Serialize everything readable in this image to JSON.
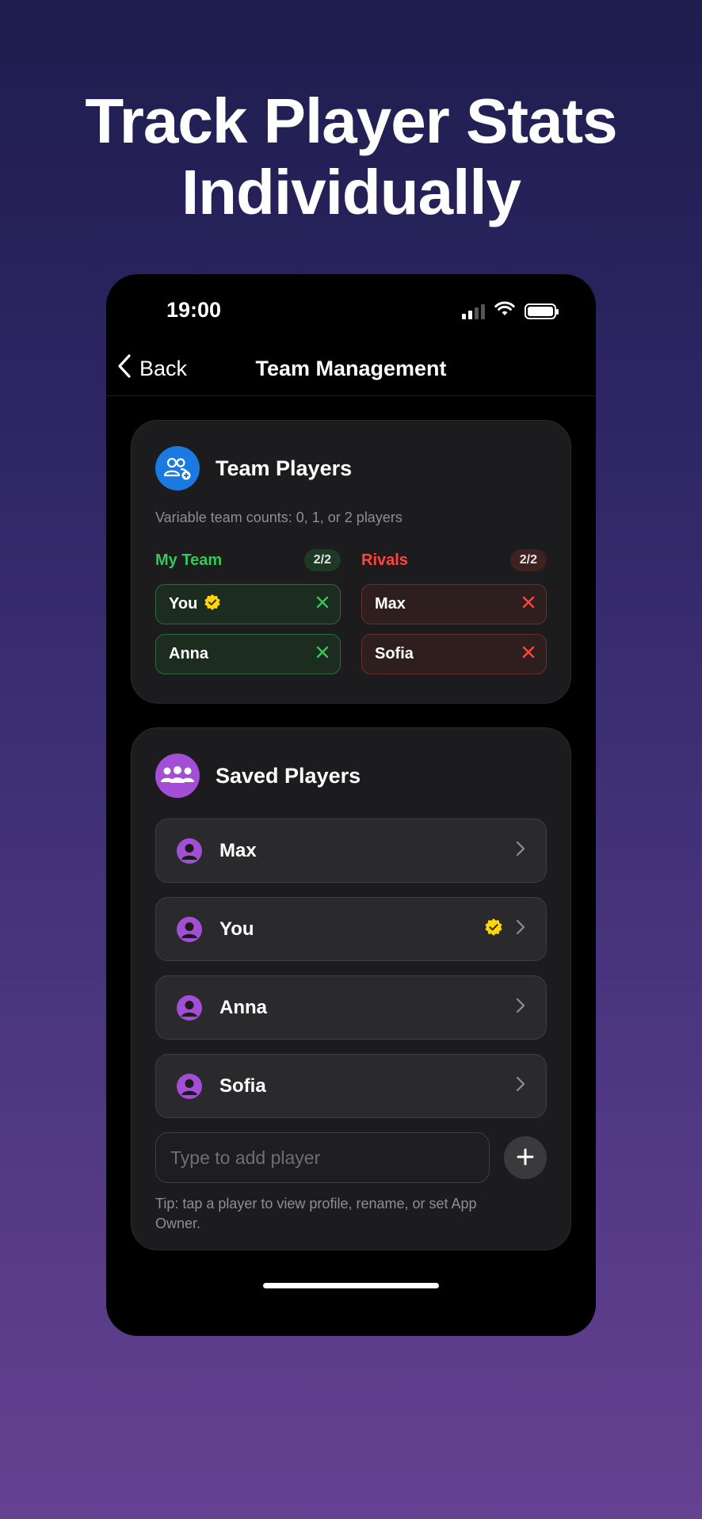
{
  "headline": {
    "line1": "Track Player Stats",
    "line2": "Individually"
  },
  "status_bar": {
    "time": "19:00"
  },
  "nav": {
    "back_label": "Back",
    "title": "Team Management"
  },
  "team_card": {
    "title": "Team Players",
    "subtitle": "Variable team counts: 0, 1, or 2 players",
    "my_team": {
      "label": "My Team",
      "count": "2/2",
      "players": [
        "You",
        "Anna"
      ],
      "owner": "You"
    },
    "rivals": {
      "label": "Rivals",
      "count": "2/2",
      "players": [
        "Max",
        "Sofia"
      ]
    }
  },
  "saved_card": {
    "title": "Saved Players",
    "players": [
      {
        "name": "Max",
        "owner": false
      },
      {
        "name": "You",
        "owner": true
      },
      {
        "name": "Anna",
        "owner": false
      },
      {
        "name": "Sofia",
        "owner": false
      }
    ],
    "input_placeholder": "Type to add player",
    "tip": "Tip: tap a player to view profile, rename, or set App Owner."
  },
  "colors": {
    "my_team": "#34c759",
    "rivals": "#ff453a",
    "owner_badge": "#ffd60a",
    "accent_blue": "#1b7ae0",
    "accent_purple": "#a24fd6"
  },
  "icons": [
    "back-chevron-icon",
    "team-add-icon",
    "group-icon",
    "person-icon",
    "verified-badge-icon",
    "remove-x-icon",
    "chevron-right-icon",
    "plus-icon",
    "wifi-icon",
    "signal-icon",
    "battery-icon"
  ]
}
